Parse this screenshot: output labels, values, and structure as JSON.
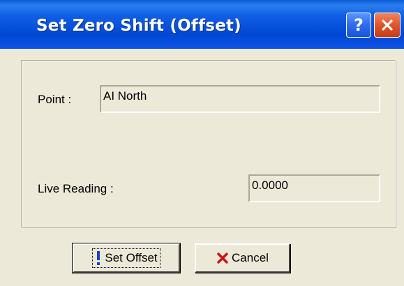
{
  "window": {
    "title": "Set Zero Shift (Offset)",
    "help_glyph": "?",
    "accent_title": "#0a4fe0",
    "accent_close": "#e0552a"
  },
  "form": {
    "point_label": "Point :",
    "point_value": "AI North",
    "live_reading_label": "Live Reading :",
    "live_reading_value": "0.0000"
  },
  "buttons": {
    "set_offset_label": "Set Offset",
    "cancel_label": "Cancel",
    "set_offset_icon": "exclamation-icon",
    "cancel_icon": "red-x-icon"
  }
}
